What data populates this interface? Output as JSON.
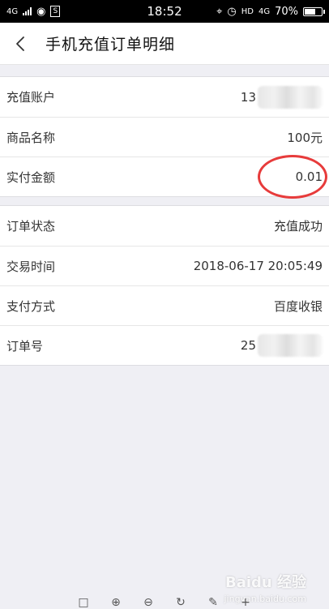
{
  "status_bar": {
    "network": "4G",
    "signal_icon": "signal-icon",
    "chat_icon": "wechat-icon",
    "app_icon": "s-app-icon",
    "time": "18:52",
    "location_icon": "location-icon",
    "alarm_icon": "alarm-icon",
    "hd_label": "HD",
    "network_right": "4G",
    "battery_percent_text": "70%",
    "battery_level": 0.7
  },
  "header": {
    "title": "手机充值订单明细"
  },
  "sections": [
    {
      "rows": [
        {
          "label": "充值账户",
          "value": "13",
          "masked": true
        },
        {
          "label": "商品名称",
          "value": "100元"
        },
        {
          "label": "实付金额",
          "value": "0.01",
          "highlighted": true
        }
      ]
    },
    {
      "rows": [
        {
          "label": "订单状态",
          "value": "充值成功"
        },
        {
          "label": "交易时间",
          "value": "2018-06-17 20:05:49"
        },
        {
          "label": "支付方式",
          "value": "百度收银"
        },
        {
          "label": "订单号",
          "value": "25",
          "masked": true
        }
      ]
    }
  ],
  "watermark": {
    "main": "Baidu 经验",
    "sub": "jingyan.baidu.com"
  },
  "colors": {
    "highlight": "#e73b3b",
    "background": "#efeff4"
  },
  "toolbar_icons": [
    "crop-icon",
    "zoom-in-icon",
    "zoom-out-icon",
    "rotate-icon",
    "pen-icon",
    "plus-icon"
  ]
}
